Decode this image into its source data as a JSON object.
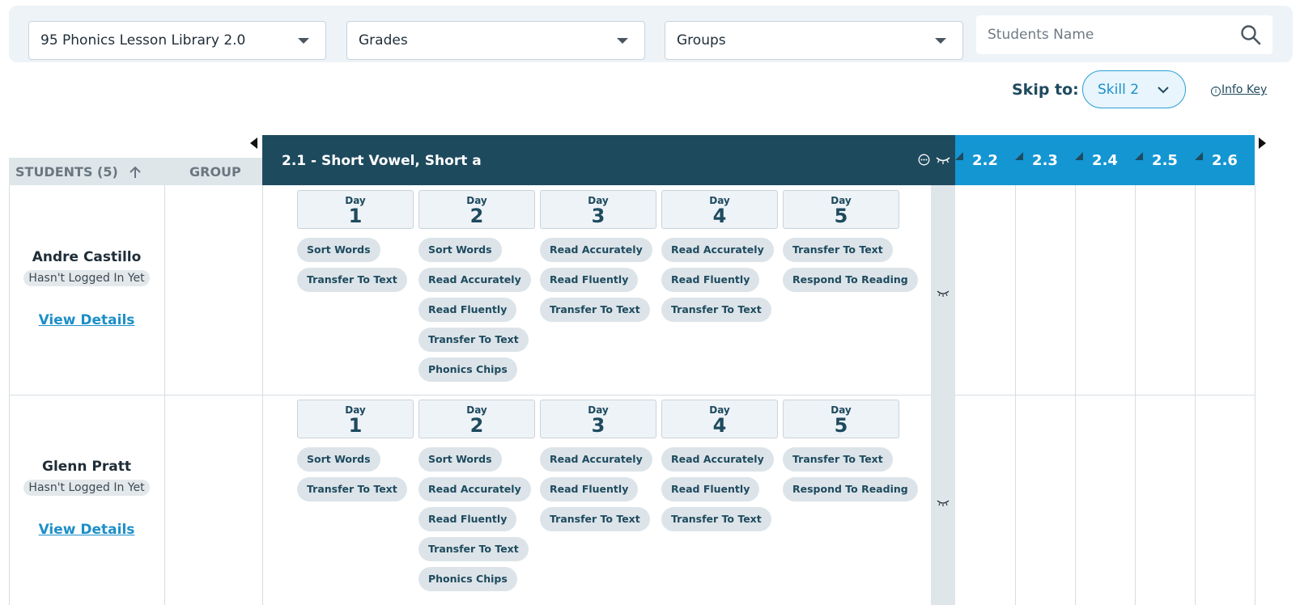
{
  "filters": {
    "library": "95 Phonics Lesson Library 2.0",
    "grades": "Grades",
    "groups": "Groups",
    "search_placeholder": "Students Name"
  },
  "skip": {
    "label": "Skip to:",
    "value": "Skill 2",
    "info_key": "Info Key"
  },
  "table": {
    "students_header": "STUDENTS (5)",
    "group_header": "GROUP",
    "current_skill": "2.1 - Short Vowel, Short a",
    "skill_tabs": [
      "2.2",
      "2.3",
      "2.4",
      "2.5",
      "2.6"
    ],
    "day_label": "Day"
  },
  "students": [
    {
      "name": "Andre Castillo",
      "status": "Hasn't Logged In Yet",
      "link": "View Details",
      "days": [
        {
          "n": "1",
          "chips": [
            "Sort Words",
            "Transfer To Text"
          ]
        },
        {
          "n": "2",
          "chips": [
            "Sort Words",
            "Read Accurately",
            "Read Fluently",
            "Transfer To Text",
            "Phonics Chips"
          ]
        },
        {
          "n": "3",
          "chips": [
            "Read Accurately",
            "Read Fluently",
            "Transfer To Text"
          ]
        },
        {
          "n": "4",
          "chips": [
            "Read Accurately",
            "Read Fluently",
            "Transfer To Text"
          ]
        },
        {
          "n": "5",
          "chips": [
            "Transfer To Text",
            "Respond To Reading"
          ]
        }
      ]
    },
    {
      "name": "Glenn Pratt",
      "status": "Hasn't Logged In Yet",
      "link": "View Details",
      "days": [
        {
          "n": "1",
          "chips": [
            "Sort Words",
            "Transfer To Text"
          ]
        },
        {
          "n": "2",
          "chips": [
            "Sort Words",
            "Read Accurately",
            "Read Fluently",
            "Transfer To Text",
            "Phonics Chips"
          ]
        },
        {
          "n": "3",
          "chips": [
            "Read Accurately",
            "Read Fluently",
            "Transfer To Text"
          ]
        },
        {
          "n": "4",
          "chips": [
            "Read Accurately",
            "Read Fluently",
            "Transfer To Text"
          ]
        },
        {
          "n": "5",
          "chips": [
            "Transfer To Text",
            "Respond To Reading"
          ]
        }
      ]
    }
  ],
  "colors": {
    "dark_teal": "#1e4a5e",
    "skill_blue": "#1496d2",
    "link_blue": "#1d8fc7"
  }
}
